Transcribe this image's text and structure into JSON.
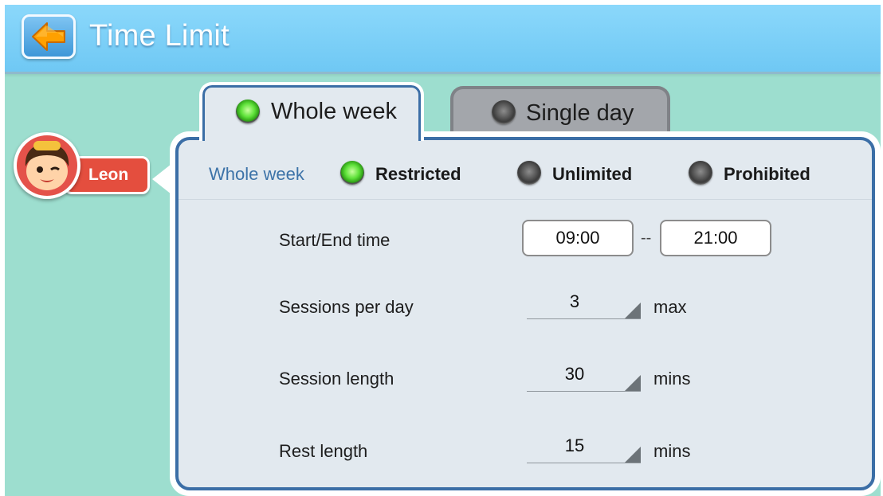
{
  "header": {
    "title": "Time Limit"
  },
  "tabs": [
    {
      "label": "Whole week",
      "selected": true
    },
    {
      "label": "Single day",
      "selected": false
    }
  ],
  "profile": {
    "name": "Leon"
  },
  "panel": {
    "mode_label": "Whole week",
    "modes": [
      {
        "label": "Restricted",
        "selected": true
      },
      {
        "label": "Unlimited",
        "selected": false
      },
      {
        "label": "Prohibited",
        "selected": false
      }
    ],
    "start_end": {
      "label": "Start/End time",
      "start": "09:00",
      "separator": "--",
      "end": "21:00"
    },
    "sessions_per_day": {
      "label": "Sessions per day",
      "value": "3",
      "unit": "max"
    },
    "session_length": {
      "label": "Session length",
      "value": "30",
      "unit": "mins"
    },
    "rest_length": {
      "label": "Rest length",
      "value": "15",
      "unit": "mins"
    }
  },
  "colors": {
    "background": "#9ddecf",
    "header": "#7dd0f8",
    "panel_border": "#3b6ea6",
    "badge": "#e44e3e",
    "radio_on": "#5fe23a"
  }
}
